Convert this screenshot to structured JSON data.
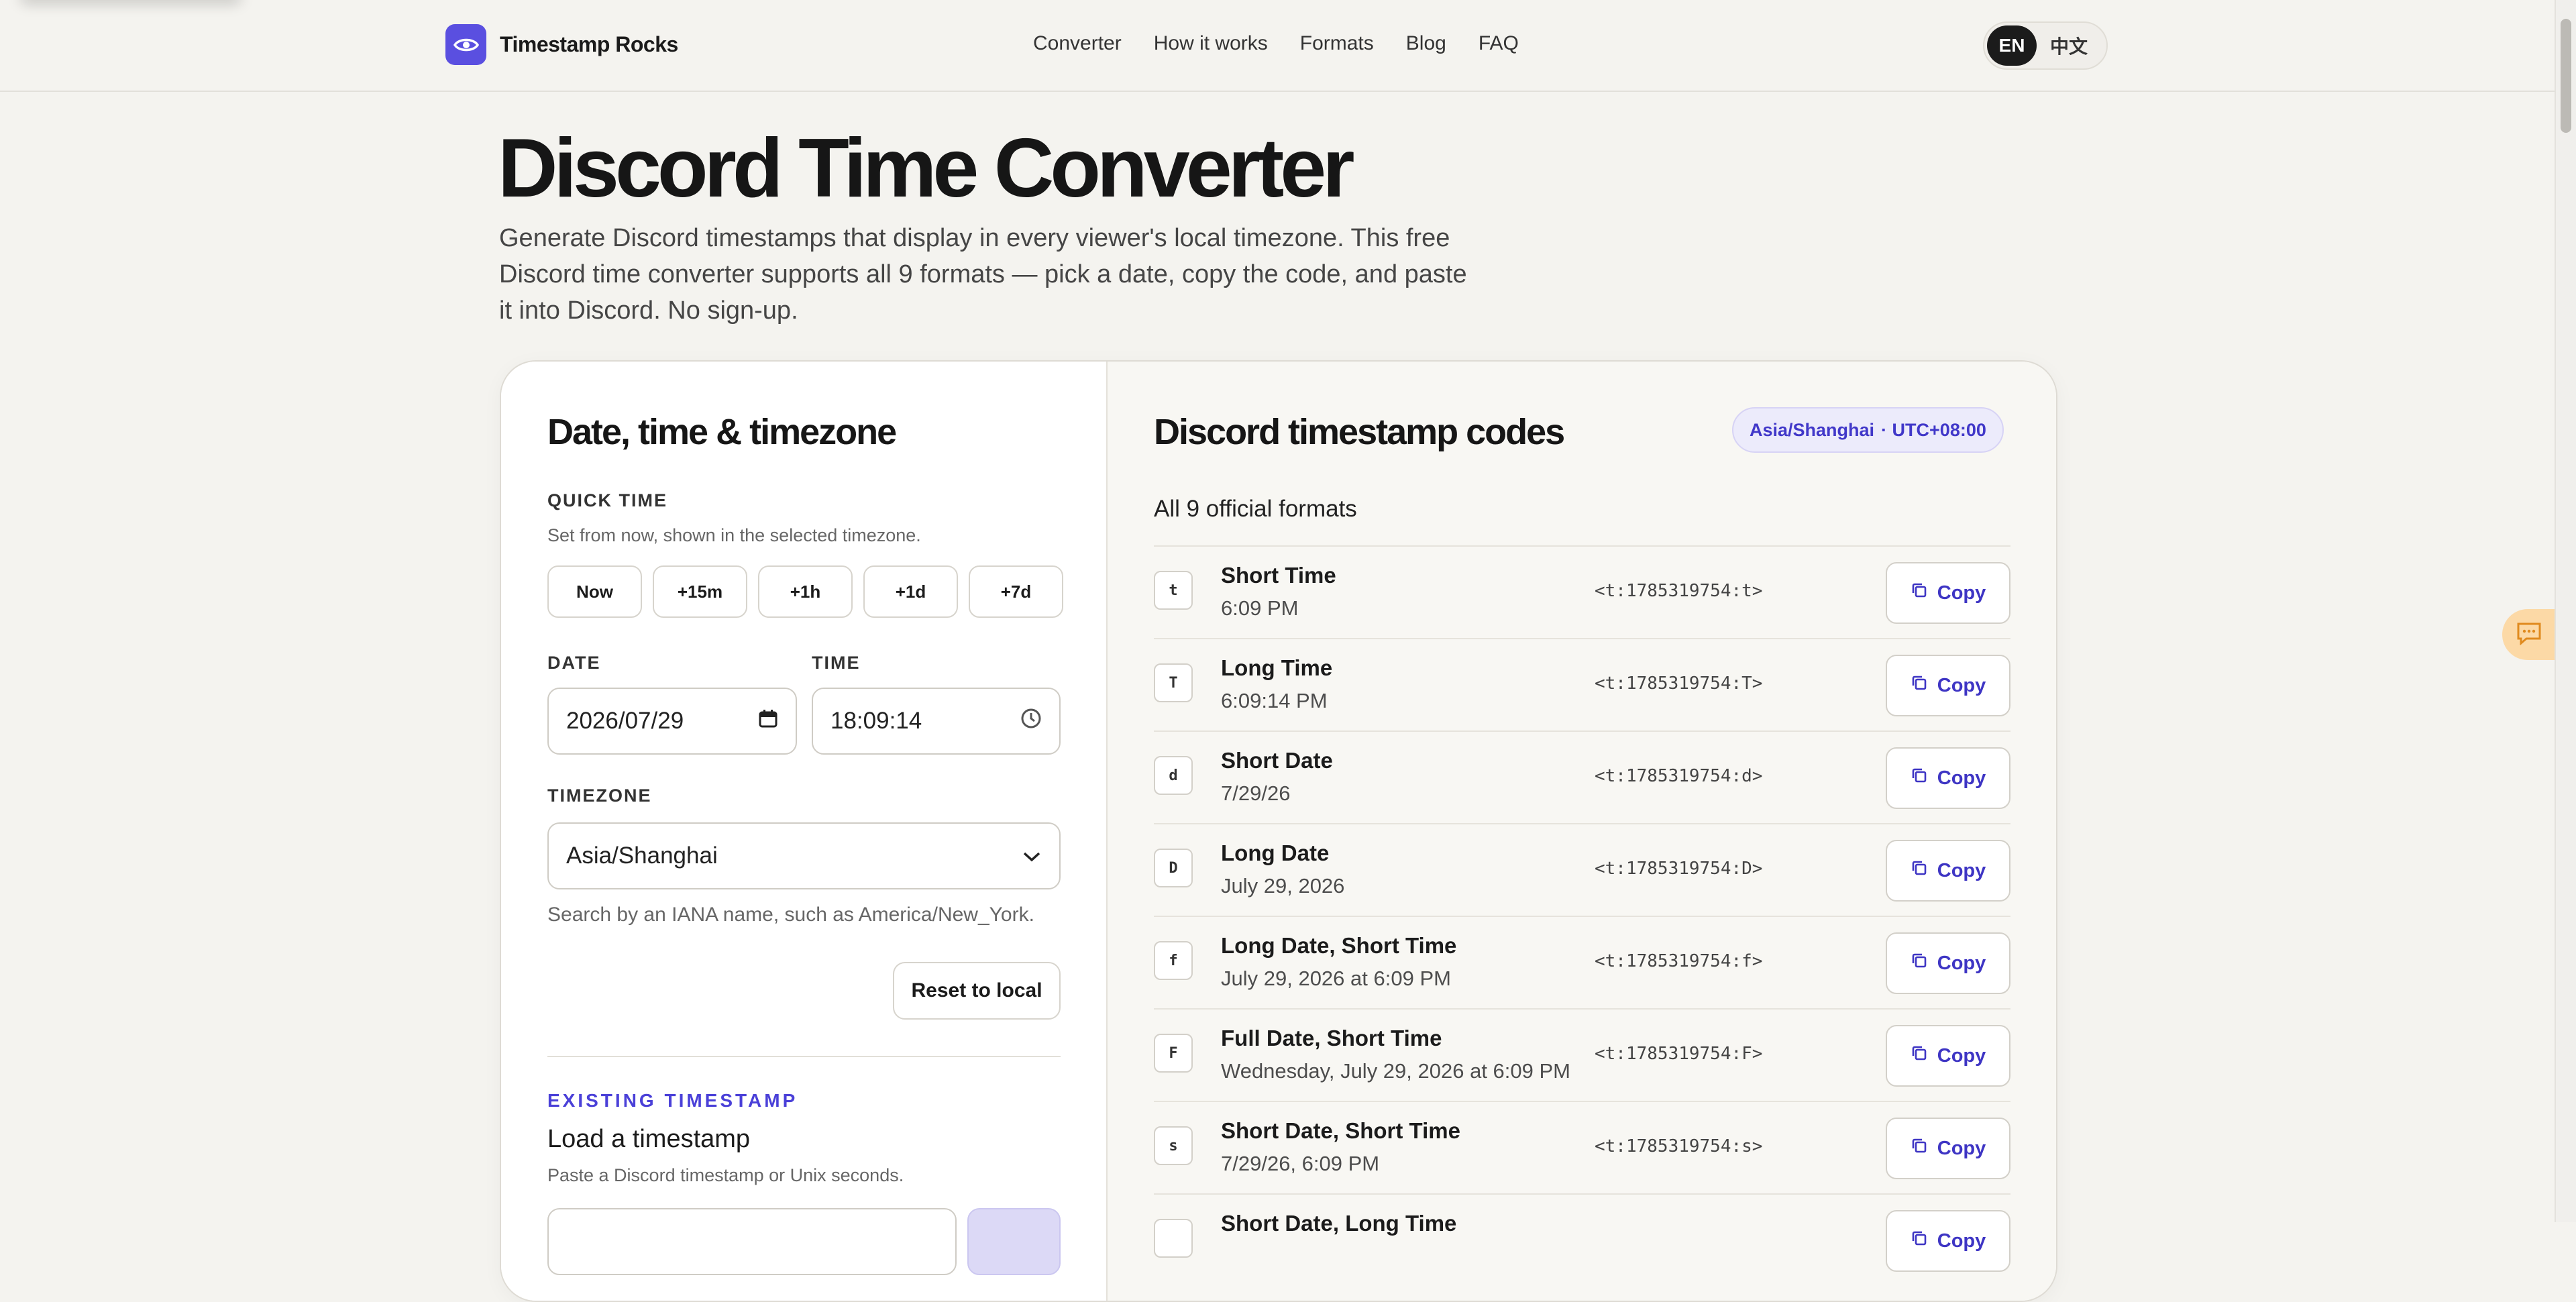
{
  "header": {
    "brand": "Timestamp Rocks",
    "nav": [
      "Converter",
      "How it works",
      "Formats",
      "Blog",
      "FAQ"
    ],
    "lang": {
      "active": "EN",
      "other": "中文"
    }
  },
  "hero": {
    "title": "Discord Time Converter",
    "lede": "Generate Discord timestamps that display in every viewer's local timezone. This free Discord time converter supports all 9 formats — pick a date, copy the code, and paste it into Discord. No sign-up."
  },
  "left": {
    "title": "Date, time & timezone",
    "quick_label": "QUICK TIME",
    "quick_hint": "Set from now, shown in the selected timezone.",
    "quick_buttons": [
      "Now",
      "+15m",
      "+1h",
      "+1d",
      "+7d"
    ],
    "date_label": "DATE",
    "date_value": "2026/07/29",
    "time_label": "TIME",
    "time_value": "18:09:14",
    "tz_label": "TIMEZONE",
    "tz_value": "Asia/Shanghai",
    "tz_hint": "Search by an IANA name, such as America/New_York.",
    "reset_label": "Reset to local",
    "existing_label": "EXISTING TIMESTAMP",
    "load_title": "Load a timestamp",
    "load_hint": "Paste a Discord timestamp or Unix seconds."
  },
  "right": {
    "title": "Discord timestamp codes",
    "tz_name": "Asia/Shanghai",
    "tz_offset": "· UTC+08:00",
    "all_label": "All 9 official formats",
    "copy_label": "Copy",
    "formats": [
      {
        "key": "t",
        "name": "Short Time",
        "preview": "6:09 PM",
        "code": "<t:1785319754:t>"
      },
      {
        "key": "T",
        "name": "Long Time",
        "preview": "6:09:14 PM",
        "code": "<t:1785319754:T>"
      },
      {
        "key": "d",
        "name": "Short Date",
        "preview": "7/29/26",
        "code": "<t:1785319754:d>"
      },
      {
        "key": "D",
        "name": "Long Date",
        "preview": "July 29, 2026",
        "code": "<t:1785319754:D>"
      },
      {
        "key": "f",
        "name": "Long Date, Short Time",
        "preview": "July 29, 2026 at 6:09 PM",
        "code": "<t:1785319754:f>"
      },
      {
        "key": "F",
        "name": "Full Date, Short Time",
        "preview": "Wednesday, July 29, 2026 at 6:09 PM",
        "code": "<t:1785319754:F>"
      },
      {
        "key": "s",
        "name": "Short Date, Short Time",
        "preview": "7/29/26, 6:09 PM",
        "code": "<t:1785319754:s>"
      },
      {
        "key": "",
        "name": "Short Date, Long Time",
        "preview": "",
        "code": ""
      }
    ]
  },
  "colors": {
    "accent": "#5a4fe0",
    "background": "#f4f3ef",
    "chat": "#fcd9a6"
  },
  "icons": [
    "eye-logo-icon",
    "calendar-icon",
    "clock-icon",
    "chevron-down-icon",
    "copy-icon",
    "chat-icon"
  ]
}
